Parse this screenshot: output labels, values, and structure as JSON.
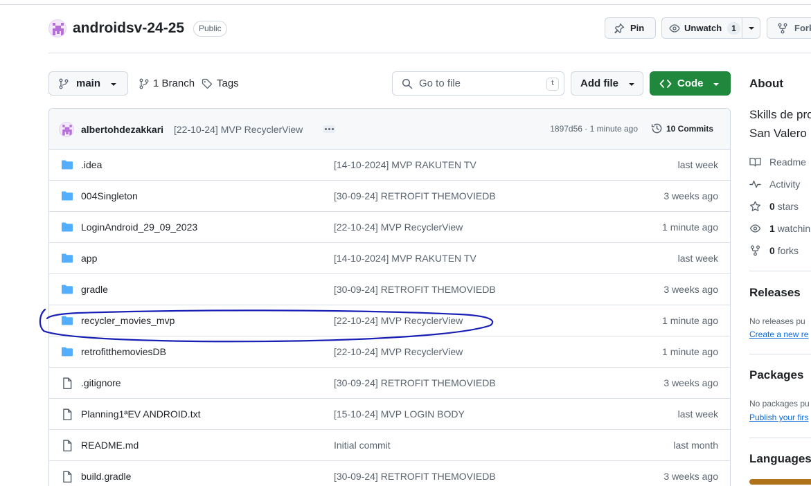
{
  "repo": {
    "name": "androidsv-24-25",
    "visibility": "Public"
  },
  "header_buttons": {
    "pin": "Pin",
    "watch": "Unwatch",
    "watch_count": "1",
    "fork": "Fork"
  },
  "toolbar": {
    "branch": "main",
    "branch_count": "1 Branch",
    "tags": "Tags",
    "search_placeholder": "Go to file",
    "search_shortcut": "t",
    "add_file": "Add file",
    "code": "Code"
  },
  "latest_commit": {
    "author": "albertohdezakkari",
    "message": "[22-10-24] MVP RecyclerView",
    "meta": "1897d56 · 1 minute ago",
    "commits": "10 Commits"
  },
  "files": [
    {
      "type": "folder",
      "name": ".idea",
      "message": "[14-10-2024] MVP RAKUTEN TV",
      "time": "last week"
    },
    {
      "type": "folder",
      "name": "004Singleton",
      "message": "[30-09-24] RETROFIT THEMOVIEDB",
      "time": "3 weeks ago"
    },
    {
      "type": "folder",
      "name": "LoginAndroid_29_09_2023",
      "message": "[22-10-24] MVP RecyclerView",
      "time": "1 minute ago"
    },
    {
      "type": "folder",
      "name": "app",
      "message": "[14-10-2024] MVP RAKUTEN TV",
      "time": "last week"
    },
    {
      "type": "folder",
      "name": "gradle",
      "message": "[30-09-24] RETROFIT THEMOVIEDB",
      "time": "3 weeks ago"
    },
    {
      "type": "folder",
      "name": "recycler_movies_mvp",
      "message": "[22-10-24] MVP RecyclerView",
      "time": "1 minute ago"
    },
    {
      "type": "folder",
      "name": "retrofitthemoviesDB",
      "message": "[22-10-24] MVP RecyclerView",
      "time": "1 minute ago"
    },
    {
      "type": "file",
      "name": ".gitignore",
      "message": "[30-09-24] RETROFIT THEMOVIEDB",
      "time": "3 weeks ago"
    },
    {
      "type": "file",
      "name": "Planning1ªEV ANDROID.txt",
      "message": "[15-10-24] MVP LOGIN BODY",
      "time": "last week"
    },
    {
      "type": "file",
      "name": "README.md",
      "message": "Initial commit",
      "time": "last month"
    },
    {
      "type": "file",
      "name": "build.gradle",
      "message": "[30-09-24] RETROFIT THEMOVIEDB",
      "time": "3 weeks ago"
    }
  ],
  "sidebar": {
    "about_title": "About",
    "about_desc_1": "Skills de pro",
    "about_desc_2": "San Valero",
    "readme": "Readme",
    "activity": "Activity",
    "stars_count": "0",
    "stars_label": "stars",
    "watching_count": "1",
    "watching_label": "watchin",
    "forks_count": "0",
    "forks_label": "forks",
    "releases_title": "Releases",
    "releases_empty": "No releases pu",
    "releases_link": "Create a new re",
    "packages_title": "Packages",
    "packages_empty": "No packages pu",
    "packages_link": "Publish your firs",
    "languages_title": "Languages"
  },
  "colors": {
    "accent_green": "#1f883d",
    "folder_blue": "#54aeff",
    "link_blue": "#0969da",
    "annotation_ink": "#1a1fb5",
    "language_java": "#b07219"
  }
}
